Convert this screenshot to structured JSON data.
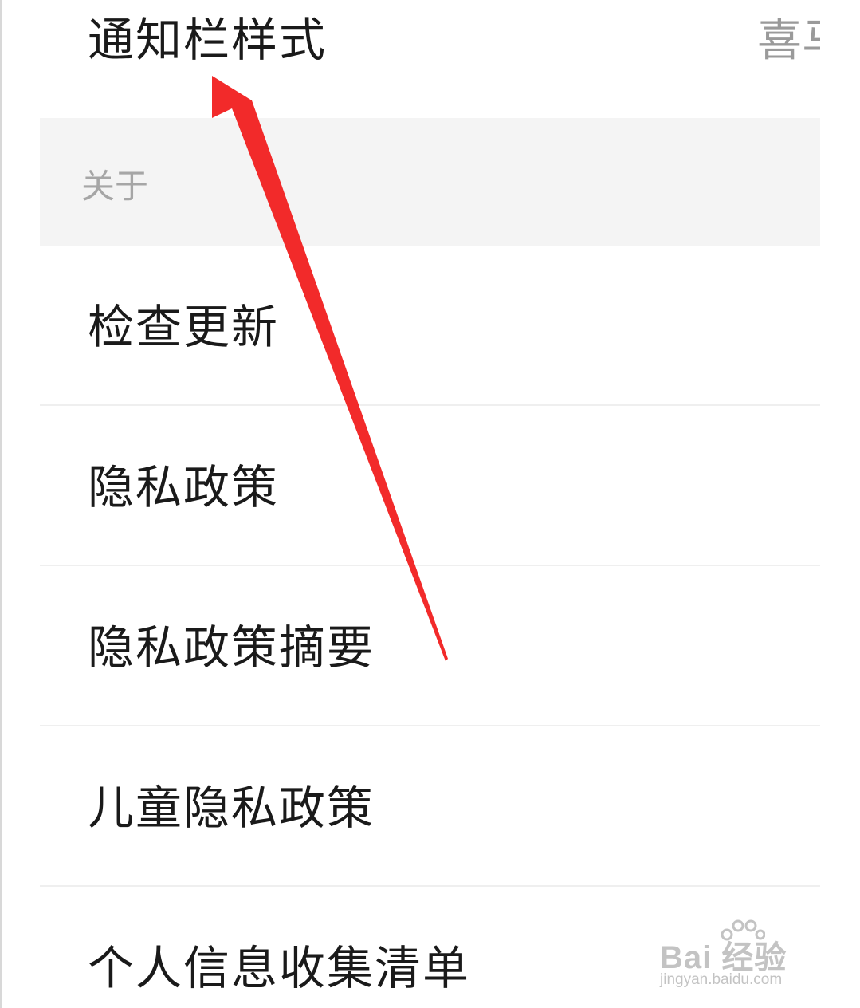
{
  "top_row": {
    "label": "通知栏样式",
    "value": "喜马"
  },
  "section": {
    "title": "关于"
  },
  "items": [
    {
      "label": "检查更新"
    },
    {
      "label": "隐私政策"
    },
    {
      "label": "隐私政策摘要"
    },
    {
      "label": "儿童隐私政策"
    },
    {
      "label": "个人信息收集清单"
    }
  ],
  "watermark": {
    "brand": "Bai 经验",
    "url": "jingyan.baidu.com"
  },
  "colors": {
    "annotation_arrow": "#f22a2a",
    "section_background": "#f4f4f4",
    "secondary_text": "#9a9a9a"
  }
}
